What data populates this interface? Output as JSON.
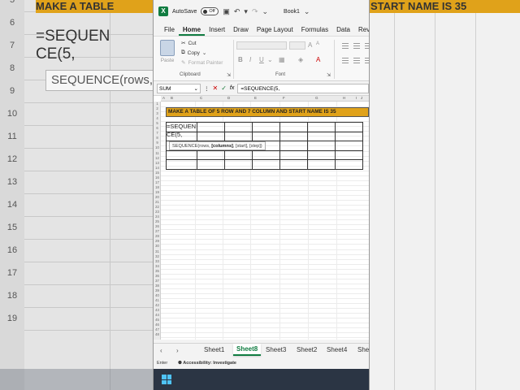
{
  "app": {
    "autosave_label": "AutoSave",
    "autosave_state": "Off",
    "workbook_title": "Book1"
  },
  "ribbon_tabs": [
    "File",
    "Home",
    "Insert",
    "Draw",
    "Page Layout",
    "Formulas",
    "Data",
    "Review"
  ],
  "active_tab": "Home",
  "clipboard": {
    "paste_label": "Paste",
    "cut_label": "Cut",
    "copy_label": "Copy",
    "format_painter_label": "Format Painter",
    "group_label": "Clipboard"
  },
  "font_group": {
    "group_label": "Font",
    "bold": "B",
    "italic": "I",
    "underline": "U",
    "font_color_letter": "A"
  },
  "formula_bar": {
    "name_box": "SUM",
    "formula": "=SEQUENCE(5,"
  },
  "columns": [
    "A",
    "B",
    "C",
    "D",
    "E",
    "F",
    "G",
    "H",
    "I",
    "J"
  ],
  "rows": [
    "1",
    "2",
    "3",
    "4",
    "5",
    "6",
    "7",
    "8",
    "9",
    "10",
    "11",
    "12",
    "13",
    "14",
    "15",
    "16",
    "17",
    "18",
    "19",
    "20",
    "21",
    "22",
    "23",
    "24",
    "25",
    "26",
    "27",
    "28",
    "29",
    "30",
    "31",
    "32",
    "33",
    "34",
    "35",
    "36",
    "37",
    "38",
    "39",
    "40",
    "41",
    "42",
    "43",
    "44",
    "45",
    "46",
    "47",
    "48"
  ],
  "sheet": {
    "banner_text": "MAKE A TABLE OF 5 ROW AND 7 COLUMN AND START NAME IS 35",
    "cell_edit_line1": "=SEQUEN",
    "cell_edit_line2": "CE(5,",
    "tooltip_func": "SEQUENCE(rows, ",
    "tooltip_bold": "[columns]",
    "tooltip_rest": ", [start], [step])"
  },
  "sheet_tabs": [
    "Sheet1",
    "Sheet8",
    "Sheet3",
    "Sheet2",
    "Sheet4",
    "Shee"
  ],
  "active_sheet": "Sheet8",
  "status": {
    "mode": "Enter",
    "accessibility": "Accessibility: Investigate"
  },
  "background": {
    "row_numbers": [
      "5",
      "6",
      "7",
      "8",
      "9",
      "10",
      "11",
      "12",
      "13",
      "14",
      "15",
      "16",
      "17",
      "18",
      "19"
    ],
    "banner_left": "MAKE A TABLE",
    "banner_right": "START NAME IS 35",
    "formula_line1": "=SEQUEN",
    "formula_line2": "CE(5,",
    "tooltip_text": "SEQUENCE(rows,"
  }
}
